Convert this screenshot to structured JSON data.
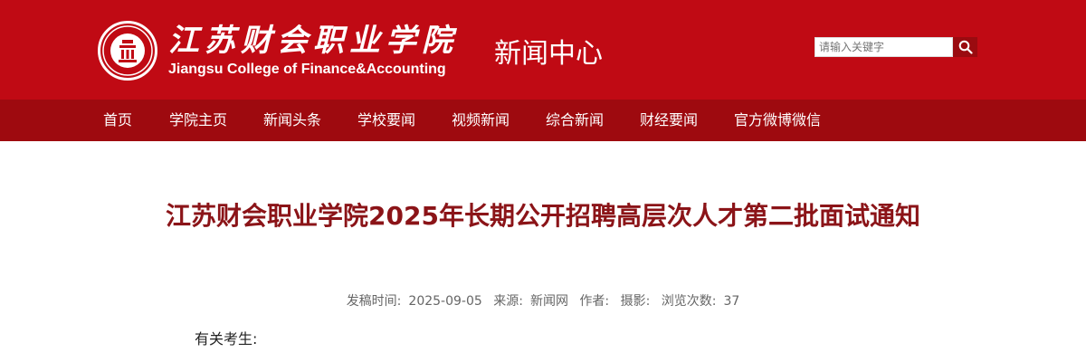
{
  "header": {
    "logo_cn": "江苏财会职业学院",
    "logo_en": "Jiangsu College of Finance&Accounting",
    "section_title": "新闻中心",
    "search": {
      "placeholder": "请输入关键字"
    }
  },
  "nav": {
    "items": [
      "首页",
      "学院主页",
      "新闻头条",
      "学校要闻",
      "视频新闻",
      "综合新闻",
      "财经要闻",
      "官方微博微信"
    ]
  },
  "article": {
    "title": "江苏财会职业学院2025年长期公开招聘高层次人才第二批面试通知",
    "meta": {
      "publish_label": "发稿时间:",
      "publish_date": "2025-09-05",
      "source_label": "来源:",
      "source": "新闻网",
      "author_label": "作者:",
      "photo_label": "摄影:",
      "views_label": "浏览次数:",
      "views": "37"
    },
    "greeting": "有关考生:"
  },
  "colors": {
    "header_bg": "#c00a14",
    "nav_bg": "#9e0a0f",
    "title_color": "#8b1418"
  }
}
